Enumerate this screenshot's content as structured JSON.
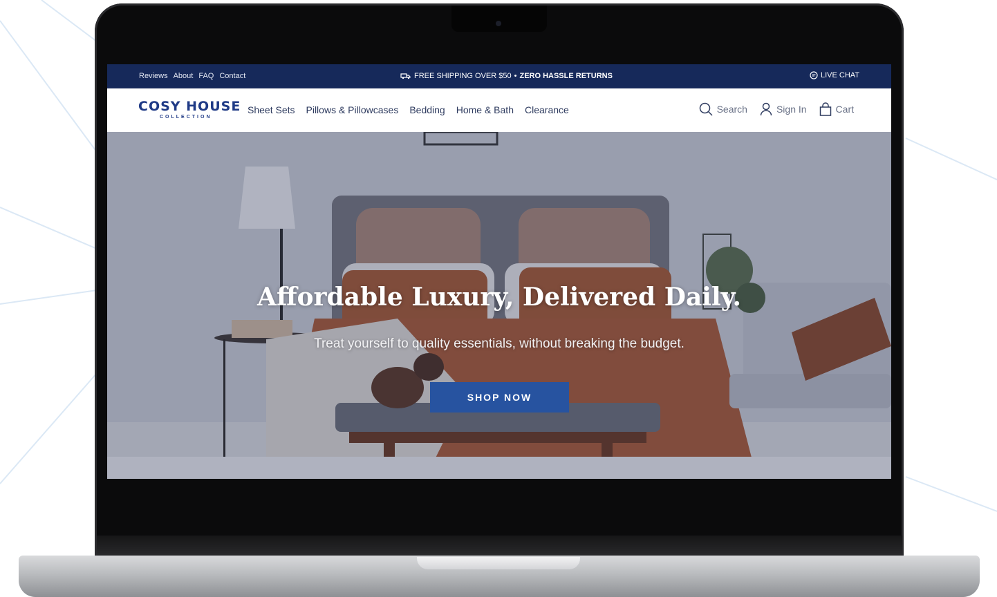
{
  "site": {
    "topbar": {
      "links": [
        "Reviews",
        "About",
        "FAQ",
        "Contact"
      ],
      "promo_main": "FREE SHIPPING OVER $50",
      "promo_separator": "•",
      "promo_bold": "ZERO HASSLE RETURNS",
      "live_chat": "LIVE CHAT"
    },
    "brand": {
      "name": "COSY HOUSE",
      "subline": "COLLECTION"
    },
    "nav": {
      "links": [
        "Sheet Sets",
        "Pillows & Pillowcases",
        "Bedding",
        "Home & Bath",
        "Clearance"
      ],
      "search": "Search",
      "sign_in": "Sign In",
      "cart": "Cart"
    },
    "hero": {
      "title": "Affordable Luxury, Delivered Daily.",
      "subtitle": "Treat yourself to quality essentials, without breaking the budget.",
      "cta": "SHOP NOW"
    }
  },
  "colors": {
    "topbar_bg": "#16295a",
    "brand_blue": "#1f3a86",
    "cta_bg": "#2753a0"
  },
  "icons": [
    "truck-icon",
    "chat-icon",
    "search-icon",
    "user-icon",
    "bag-icon"
  ]
}
